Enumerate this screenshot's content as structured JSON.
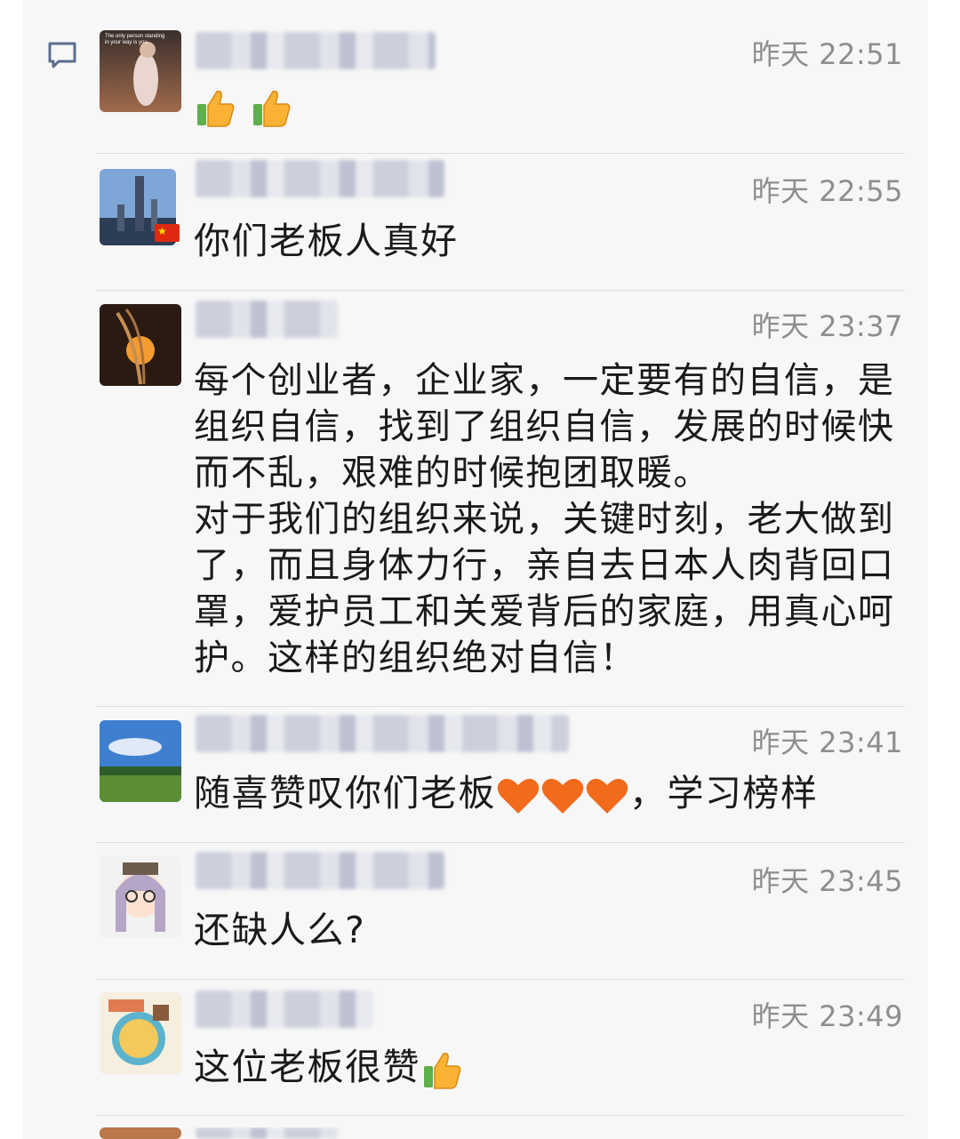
{
  "comments": [
    {
      "time": "昨天 22:51",
      "text": ""
    },
    {
      "time": "昨天 22:55",
      "text": "你们老板人真好"
    },
    {
      "time": "昨天 23:37",
      "text": "每个创业者，企业家，一定要有的自信，是组织自信，找到了组织自信，发展的时候快而不乱，艰难的时候抱团取暖。\n对于我们的组织来说，关键时刻，老大做到了，而且身体力行，亲自去日本人肉背回口罩，爱护员工和关爱背后的家庭，用真心呵护。这样的组织绝对自信！"
    },
    {
      "time": "昨天 23:41",
      "text_before": "随喜赞叹你们老板",
      "text_after": "，学习榜样"
    },
    {
      "time": "昨天 23:45",
      "text": "还缺人么?"
    },
    {
      "time": "昨天 23:49",
      "text": "这位老板很赞"
    }
  ],
  "avatar1_caption": "The only person standing in your way is you.",
  "icons": [
    "comment-icon",
    "thumbs-up-icon",
    "heart-icon",
    "china-flag-icon"
  ]
}
